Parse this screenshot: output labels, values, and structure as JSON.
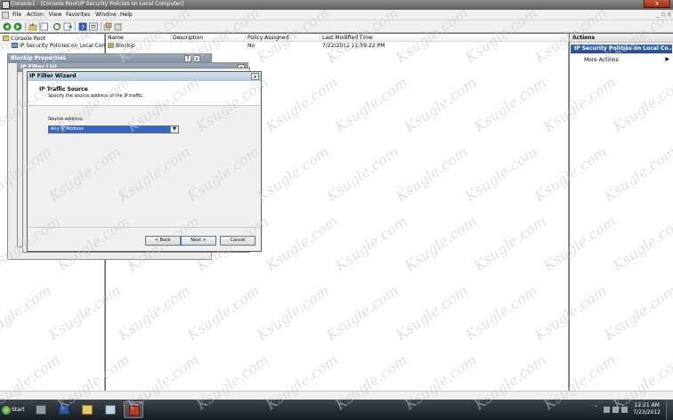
{
  "window": {
    "title": "Console1 - [Console Root\\IP Security Policies on Local Computer]",
    "close_glyph": "x"
  },
  "menu": {
    "items": [
      "File",
      "Action",
      "View",
      "Favorites",
      "Window",
      "Help"
    ],
    "right_controls": "_ ▫ x"
  },
  "toolbar": {
    "icons": [
      "back-icon",
      "forward-icon",
      "up-icon",
      "show-hide-tree-icon",
      "refresh-icon",
      "export-icon",
      "help-icon",
      "properties-icon",
      "add-policy-icon",
      "manage-filters-icon"
    ]
  },
  "tree": {
    "root": "Console Root",
    "child": "IP Security Policies on Local Computer"
  },
  "list": {
    "columns": [
      "Name",
      "Description",
      "Policy Assigned",
      "Last Modified Time"
    ],
    "rows": [
      {
        "name": "Blockip",
        "description": "",
        "assigned": "No",
        "modified": "7/22/2012 11:59:22 PM"
      }
    ]
  },
  "actions": {
    "header": "Actions",
    "subheader": "IP Security Policies on Local Co...",
    "more": "More Actions",
    "more_arrow": "▶"
  },
  "background_windows": {
    "properties_title": "Blockip Properties",
    "filter_list_title": "IP Filter List",
    "help_glyph": "?",
    "close_glyph": "x"
  },
  "wizard": {
    "title": "IP Filter Wizard",
    "close_glyph": "x",
    "heading": "IP Traffic Source",
    "subheading": "Specify the source address of the IP traffic.",
    "source_label": "Source address:",
    "source_value": "Any IP Address",
    "dropdown_arrow": "▼",
    "back_label": "< Back",
    "next_label": "Next >",
    "cancel_label": "Cancel"
  },
  "taskbar": {
    "start_label": "Start",
    "clock_time": "12:21 AM",
    "clock_date": "7/23/2012"
  },
  "watermark": {
    "text": "Ksugle.com"
  }
}
